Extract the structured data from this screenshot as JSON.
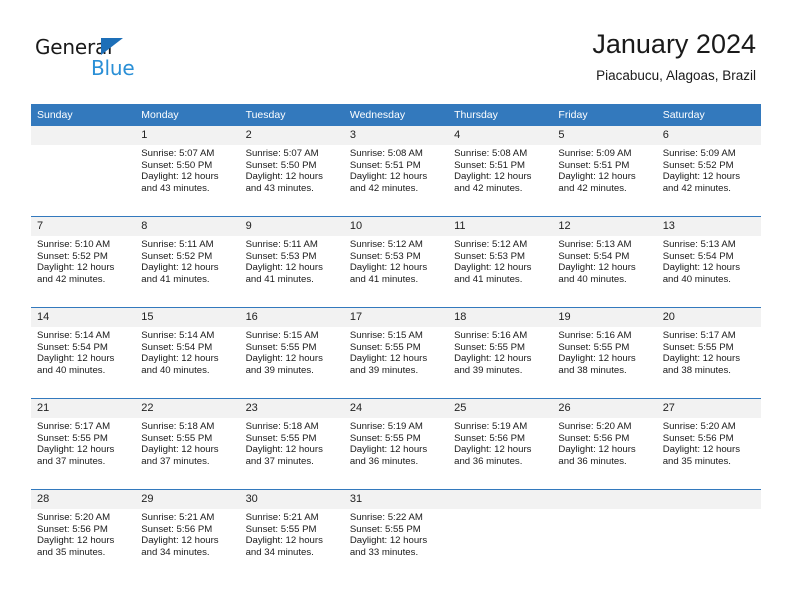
{
  "logo": {
    "primary_text": "General",
    "secondary_text": "Blue",
    "triangle_color": "#1d6fb8",
    "secondary_color": "#2a8fd6"
  },
  "header": {
    "title": "January 2024",
    "subtitle": "Piacabucu, Alagoas, Brazil"
  },
  "theme": {
    "header_row_background": "#3379bd",
    "header_row_text": "#ffffff",
    "daynum_background": "#f2f2f2",
    "separator_color": "#3379bd"
  },
  "weekday_headers": [
    "Sunday",
    "Monday",
    "Tuesday",
    "Wednesday",
    "Thursday",
    "Friday",
    "Saturday"
  ],
  "labels": {
    "sunrise_prefix": "Sunrise:",
    "sunset_prefix": "Sunset:",
    "daylight_prefix": "Daylight:"
  },
  "weeks": [
    [
      {
        "day": "",
        "sunrise": "",
        "sunset": "",
        "daylight_line1": "",
        "daylight_line2": "",
        "blank": true
      },
      {
        "day": "1",
        "sunrise": "Sunrise: 5:07 AM",
        "sunset": "Sunset: 5:50 PM",
        "daylight_line1": "Daylight: 12 hours",
        "daylight_line2": "and 43 minutes."
      },
      {
        "day": "2",
        "sunrise": "Sunrise: 5:07 AM",
        "sunset": "Sunset: 5:50 PM",
        "daylight_line1": "Daylight: 12 hours",
        "daylight_line2": "and 43 minutes."
      },
      {
        "day": "3",
        "sunrise": "Sunrise: 5:08 AM",
        "sunset": "Sunset: 5:51 PM",
        "daylight_line1": "Daylight: 12 hours",
        "daylight_line2": "and 42 minutes."
      },
      {
        "day": "4",
        "sunrise": "Sunrise: 5:08 AM",
        "sunset": "Sunset: 5:51 PM",
        "daylight_line1": "Daylight: 12 hours",
        "daylight_line2": "and 42 minutes."
      },
      {
        "day": "5",
        "sunrise": "Sunrise: 5:09 AM",
        "sunset": "Sunset: 5:51 PM",
        "daylight_line1": "Daylight: 12 hours",
        "daylight_line2": "and 42 minutes."
      },
      {
        "day": "6",
        "sunrise": "Sunrise: 5:09 AM",
        "sunset": "Sunset: 5:52 PM",
        "daylight_line1": "Daylight: 12 hours",
        "daylight_line2": "and 42 minutes."
      }
    ],
    [
      {
        "day": "7",
        "sunrise": "Sunrise: 5:10 AM",
        "sunset": "Sunset: 5:52 PM",
        "daylight_line1": "Daylight: 12 hours",
        "daylight_line2": "and 42 minutes."
      },
      {
        "day": "8",
        "sunrise": "Sunrise: 5:11 AM",
        "sunset": "Sunset: 5:52 PM",
        "daylight_line1": "Daylight: 12 hours",
        "daylight_line2": "and 41 minutes."
      },
      {
        "day": "9",
        "sunrise": "Sunrise: 5:11 AM",
        "sunset": "Sunset: 5:53 PM",
        "daylight_line1": "Daylight: 12 hours",
        "daylight_line2": "and 41 minutes."
      },
      {
        "day": "10",
        "sunrise": "Sunrise: 5:12 AM",
        "sunset": "Sunset: 5:53 PM",
        "daylight_line1": "Daylight: 12 hours",
        "daylight_line2": "and 41 minutes."
      },
      {
        "day": "11",
        "sunrise": "Sunrise: 5:12 AM",
        "sunset": "Sunset: 5:53 PM",
        "daylight_line1": "Daylight: 12 hours",
        "daylight_line2": "and 41 minutes."
      },
      {
        "day": "12",
        "sunrise": "Sunrise: 5:13 AM",
        "sunset": "Sunset: 5:54 PM",
        "daylight_line1": "Daylight: 12 hours",
        "daylight_line2": "and 40 minutes."
      },
      {
        "day": "13",
        "sunrise": "Sunrise: 5:13 AM",
        "sunset": "Sunset: 5:54 PM",
        "daylight_line1": "Daylight: 12 hours",
        "daylight_line2": "and 40 minutes."
      }
    ],
    [
      {
        "day": "14",
        "sunrise": "Sunrise: 5:14 AM",
        "sunset": "Sunset: 5:54 PM",
        "daylight_line1": "Daylight: 12 hours",
        "daylight_line2": "and 40 minutes."
      },
      {
        "day": "15",
        "sunrise": "Sunrise: 5:14 AM",
        "sunset": "Sunset: 5:54 PM",
        "daylight_line1": "Daylight: 12 hours",
        "daylight_line2": "and 40 minutes."
      },
      {
        "day": "16",
        "sunrise": "Sunrise: 5:15 AM",
        "sunset": "Sunset: 5:55 PM",
        "daylight_line1": "Daylight: 12 hours",
        "daylight_line2": "and 39 minutes."
      },
      {
        "day": "17",
        "sunrise": "Sunrise: 5:15 AM",
        "sunset": "Sunset: 5:55 PM",
        "daylight_line1": "Daylight: 12 hours",
        "daylight_line2": "and 39 minutes."
      },
      {
        "day": "18",
        "sunrise": "Sunrise: 5:16 AM",
        "sunset": "Sunset: 5:55 PM",
        "daylight_line1": "Daylight: 12 hours",
        "daylight_line2": "and 39 minutes."
      },
      {
        "day": "19",
        "sunrise": "Sunrise: 5:16 AM",
        "sunset": "Sunset: 5:55 PM",
        "daylight_line1": "Daylight: 12 hours",
        "daylight_line2": "and 38 minutes."
      },
      {
        "day": "20",
        "sunrise": "Sunrise: 5:17 AM",
        "sunset": "Sunset: 5:55 PM",
        "daylight_line1": "Daylight: 12 hours",
        "daylight_line2": "and 38 minutes."
      }
    ],
    [
      {
        "day": "21",
        "sunrise": "Sunrise: 5:17 AM",
        "sunset": "Sunset: 5:55 PM",
        "daylight_line1": "Daylight: 12 hours",
        "daylight_line2": "and 37 minutes."
      },
      {
        "day": "22",
        "sunrise": "Sunrise: 5:18 AM",
        "sunset": "Sunset: 5:55 PM",
        "daylight_line1": "Daylight: 12 hours",
        "daylight_line2": "and 37 minutes."
      },
      {
        "day": "23",
        "sunrise": "Sunrise: 5:18 AM",
        "sunset": "Sunset: 5:55 PM",
        "daylight_line1": "Daylight: 12 hours",
        "daylight_line2": "and 37 minutes."
      },
      {
        "day": "24",
        "sunrise": "Sunrise: 5:19 AM",
        "sunset": "Sunset: 5:55 PM",
        "daylight_line1": "Daylight: 12 hours",
        "daylight_line2": "and 36 minutes."
      },
      {
        "day": "25",
        "sunrise": "Sunrise: 5:19 AM",
        "sunset": "Sunset: 5:56 PM",
        "daylight_line1": "Daylight: 12 hours",
        "daylight_line2": "and 36 minutes."
      },
      {
        "day": "26",
        "sunrise": "Sunrise: 5:20 AM",
        "sunset": "Sunset: 5:56 PM",
        "daylight_line1": "Daylight: 12 hours",
        "daylight_line2": "and 36 minutes."
      },
      {
        "day": "27",
        "sunrise": "Sunrise: 5:20 AM",
        "sunset": "Sunset: 5:56 PM",
        "daylight_line1": "Daylight: 12 hours",
        "daylight_line2": "and 35 minutes."
      }
    ],
    [
      {
        "day": "28",
        "sunrise": "Sunrise: 5:20 AM",
        "sunset": "Sunset: 5:56 PM",
        "daylight_line1": "Daylight: 12 hours",
        "daylight_line2": "and 35 minutes."
      },
      {
        "day": "29",
        "sunrise": "Sunrise: 5:21 AM",
        "sunset": "Sunset: 5:56 PM",
        "daylight_line1": "Daylight: 12 hours",
        "daylight_line2": "and 34 minutes."
      },
      {
        "day": "30",
        "sunrise": "Sunrise: 5:21 AM",
        "sunset": "Sunset: 5:55 PM",
        "daylight_line1": "Daylight: 12 hours",
        "daylight_line2": "and 34 minutes."
      },
      {
        "day": "31",
        "sunrise": "Sunrise: 5:22 AM",
        "sunset": "Sunset: 5:55 PM",
        "daylight_line1": "Daylight: 12 hours",
        "daylight_line2": "and 33 minutes."
      },
      {
        "day": "",
        "sunrise": "",
        "sunset": "",
        "daylight_line1": "",
        "daylight_line2": "",
        "blank": true
      },
      {
        "day": "",
        "sunrise": "",
        "sunset": "",
        "daylight_line1": "",
        "daylight_line2": "",
        "blank": true
      },
      {
        "day": "",
        "sunrise": "",
        "sunset": "",
        "daylight_line1": "",
        "daylight_line2": "",
        "blank": true
      }
    ]
  ]
}
